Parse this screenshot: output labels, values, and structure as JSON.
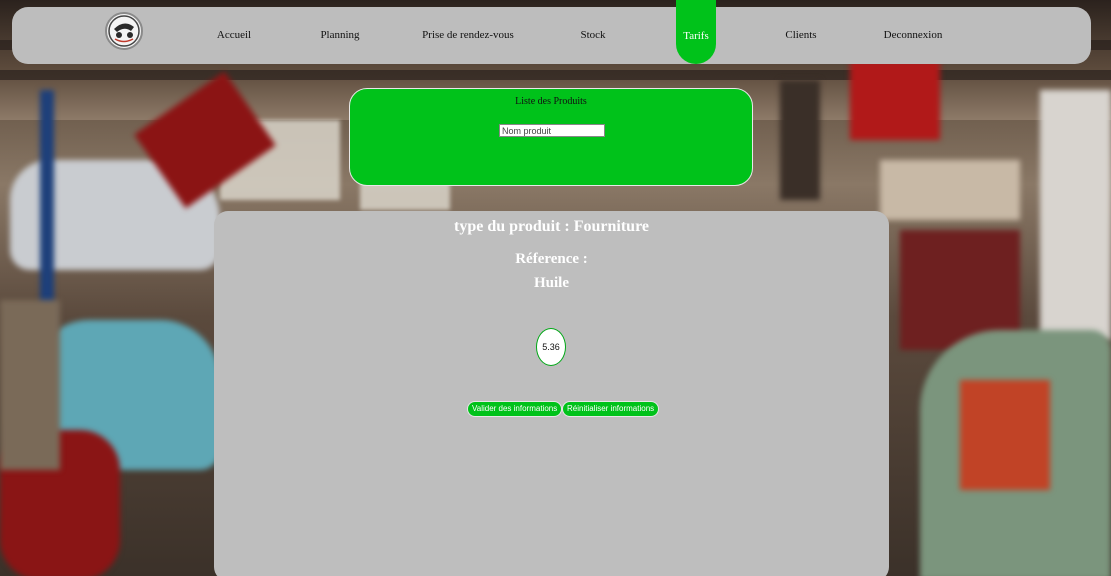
{
  "nav": {
    "items": [
      {
        "label": "Accueil"
      },
      {
        "label": "Planning"
      },
      {
        "label": "Prise de rendez-vous"
      },
      {
        "label": "Stock"
      },
      {
        "label": "Tarifs"
      },
      {
        "label": "Clients"
      },
      {
        "label": "Deconnexion"
      }
    ],
    "active": "Tarifs"
  },
  "list_panel": {
    "title": "Liste des Produits",
    "search_placeholder": "Nom produit"
  },
  "product": {
    "type_line": "type du produit : Fourniture",
    "reference_label": "Réference :",
    "reference_value": "Huile",
    "price": "5.36"
  },
  "actions": {
    "validate_label": "Valider des informations",
    "reset_label": "Réinitialiser informations"
  },
  "colors": {
    "accent_green": "#00c21a",
    "nav_bg": "#bdbdbd",
    "card_bg": "#bebebe"
  }
}
